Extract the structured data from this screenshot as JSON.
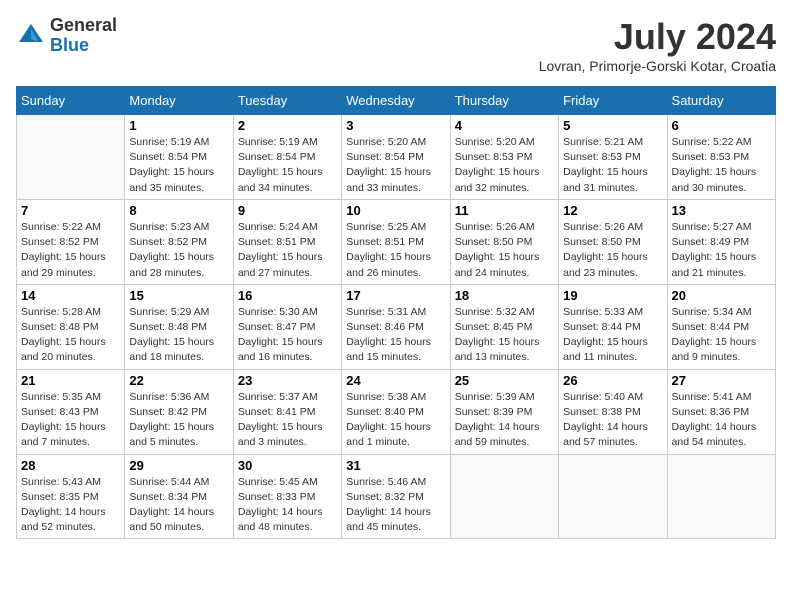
{
  "logo": {
    "general": "General",
    "blue": "Blue"
  },
  "title": "July 2024",
  "location": "Lovran, Primorje-Gorski Kotar, Croatia",
  "days_of_week": [
    "Sunday",
    "Monday",
    "Tuesday",
    "Wednesday",
    "Thursday",
    "Friday",
    "Saturday"
  ],
  "weeks": [
    [
      {
        "day": "",
        "info": ""
      },
      {
        "day": "1",
        "info": "Sunrise: 5:19 AM\nSunset: 8:54 PM\nDaylight: 15 hours\nand 35 minutes."
      },
      {
        "day": "2",
        "info": "Sunrise: 5:19 AM\nSunset: 8:54 PM\nDaylight: 15 hours\nand 34 minutes."
      },
      {
        "day": "3",
        "info": "Sunrise: 5:20 AM\nSunset: 8:54 PM\nDaylight: 15 hours\nand 33 minutes."
      },
      {
        "day": "4",
        "info": "Sunrise: 5:20 AM\nSunset: 8:53 PM\nDaylight: 15 hours\nand 32 minutes."
      },
      {
        "day": "5",
        "info": "Sunrise: 5:21 AM\nSunset: 8:53 PM\nDaylight: 15 hours\nand 31 minutes."
      },
      {
        "day": "6",
        "info": "Sunrise: 5:22 AM\nSunset: 8:53 PM\nDaylight: 15 hours\nand 30 minutes."
      }
    ],
    [
      {
        "day": "7",
        "info": "Sunrise: 5:22 AM\nSunset: 8:52 PM\nDaylight: 15 hours\nand 29 minutes."
      },
      {
        "day": "8",
        "info": "Sunrise: 5:23 AM\nSunset: 8:52 PM\nDaylight: 15 hours\nand 28 minutes."
      },
      {
        "day": "9",
        "info": "Sunrise: 5:24 AM\nSunset: 8:51 PM\nDaylight: 15 hours\nand 27 minutes."
      },
      {
        "day": "10",
        "info": "Sunrise: 5:25 AM\nSunset: 8:51 PM\nDaylight: 15 hours\nand 26 minutes."
      },
      {
        "day": "11",
        "info": "Sunrise: 5:26 AM\nSunset: 8:50 PM\nDaylight: 15 hours\nand 24 minutes."
      },
      {
        "day": "12",
        "info": "Sunrise: 5:26 AM\nSunset: 8:50 PM\nDaylight: 15 hours\nand 23 minutes."
      },
      {
        "day": "13",
        "info": "Sunrise: 5:27 AM\nSunset: 8:49 PM\nDaylight: 15 hours\nand 21 minutes."
      }
    ],
    [
      {
        "day": "14",
        "info": "Sunrise: 5:28 AM\nSunset: 8:48 PM\nDaylight: 15 hours\nand 20 minutes."
      },
      {
        "day": "15",
        "info": "Sunrise: 5:29 AM\nSunset: 8:48 PM\nDaylight: 15 hours\nand 18 minutes."
      },
      {
        "day": "16",
        "info": "Sunrise: 5:30 AM\nSunset: 8:47 PM\nDaylight: 15 hours\nand 16 minutes."
      },
      {
        "day": "17",
        "info": "Sunrise: 5:31 AM\nSunset: 8:46 PM\nDaylight: 15 hours\nand 15 minutes."
      },
      {
        "day": "18",
        "info": "Sunrise: 5:32 AM\nSunset: 8:45 PM\nDaylight: 15 hours\nand 13 minutes."
      },
      {
        "day": "19",
        "info": "Sunrise: 5:33 AM\nSunset: 8:44 PM\nDaylight: 15 hours\nand 11 minutes."
      },
      {
        "day": "20",
        "info": "Sunrise: 5:34 AM\nSunset: 8:44 PM\nDaylight: 15 hours\nand 9 minutes."
      }
    ],
    [
      {
        "day": "21",
        "info": "Sunrise: 5:35 AM\nSunset: 8:43 PM\nDaylight: 15 hours\nand 7 minutes."
      },
      {
        "day": "22",
        "info": "Sunrise: 5:36 AM\nSunset: 8:42 PM\nDaylight: 15 hours\nand 5 minutes."
      },
      {
        "day": "23",
        "info": "Sunrise: 5:37 AM\nSunset: 8:41 PM\nDaylight: 15 hours\nand 3 minutes."
      },
      {
        "day": "24",
        "info": "Sunrise: 5:38 AM\nSunset: 8:40 PM\nDaylight: 15 hours\nand 1 minute."
      },
      {
        "day": "25",
        "info": "Sunrise: 5:39 AM\nSunset: 8:39 PM\nDaylight: 14 hours\nand 59 minutes."
      },
      {
        "day": "26",
        "info": "Sunrise: 5:40 AM\nSunset: 8:38 PM\nDaylight: 14 hours\nand 57 minutes."
      },
      {
        "day": "27",
        "info": "Sunrise: 5:41 AM\nSunset: 8:36 PM\nDaylight: 14 hours\nand 54 minutes."
      }
    ],
    [
      {
        "day": "28",
        "info": "Sunrise: 5:43 AM\nSunset: 8:35 PM\nDaylight: 14 hours\nand 52 minutes."
      },
      {
        "day": "29",
        "info": "Sunrise: 5:44 AM\nSunset: 8:34 PM\nDaylight: 14 hours\nand 50 minutes."
      },
      {
        "day": "30",
        "info": "Sunrise: 5:45 AM\nSunset: 8:33 PM\nDaylight: 14 hours\nand 48 minutes."
      },
      {
        "day": "31",
        "info": "Sunrise: 5:46 AM\nSunset: 8:32 PM\nDaylight: 14 hours\nand 45 minutes."
      },
      {
        "day": "",
        "info": ""
      },
      {
        "day": "",
        "info": ""
      },
      {
        "day": "",
        "info": ""
      }
    ]
  ]
}
